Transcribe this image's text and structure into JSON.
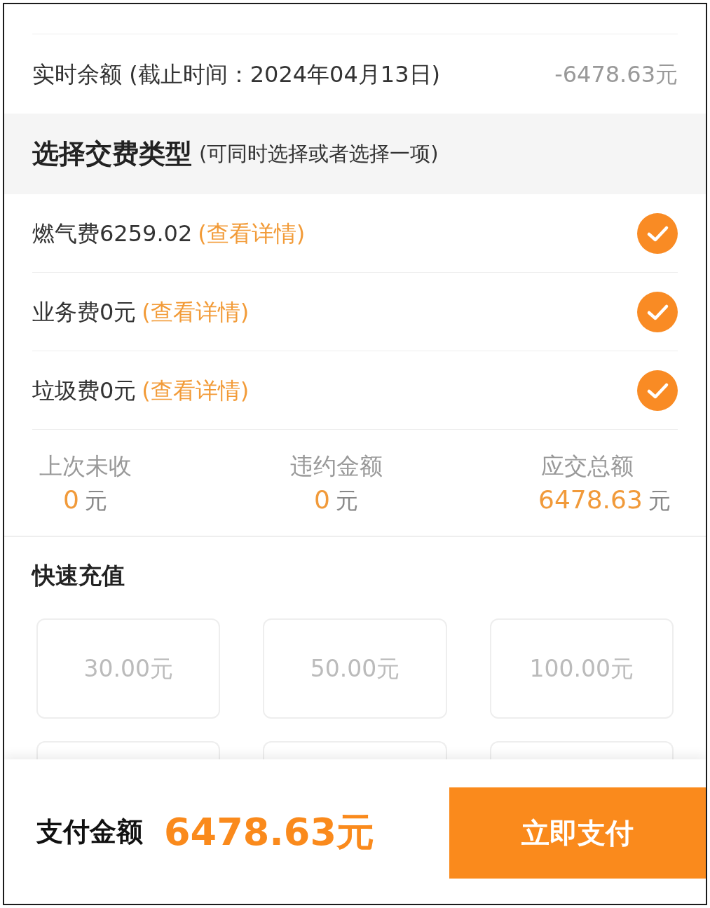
{
  "balance": {
    "label": "实时余额 (截止时间：2024年04月13日)",
    "value": "-6478.63元"
  },
  "fee_type_section": {
    "title": "选择交费类型",
    "hint": "(可同时选择或者选择一项)"
  },
  "fee_items": [
    {
      "label": "燃气费6259.02",
      "link": "(查看详情)",
      "checked": true
    },
    {
      "label": "业务费0元",
      "link": "(查看详情)",
      "checked": true
    },
    {
      "label": "垃圾费0元",
      "link": "(查看详情)",
      "checked": true
    }
  ],
  "summary": [
    {
      "label": "上次未收",
      "amount": "0",
      "unit": "元"
    },
    {
      "label": "违约金额",
      "amount": "0",
      "unit": "元"
    },
    {
      "label": "应交总额",
      "amount": "6478.63",
      "unit": "元"
    }
  ],
  "quick_recharge": {
    "title": "快速充值",
    "options": [
      {
        "label": "30.00元",
        "selected": false
      },
      {
        "label": "50.00元",
        "selected": false
      },
      {
        "label": "100.00元",
        "selected": false
      }
    ]
  },
  "payment_bar": {
    "label": "支付金额",
    "amount": "6478.63元",
    "button": "立即支付"
  }
}
